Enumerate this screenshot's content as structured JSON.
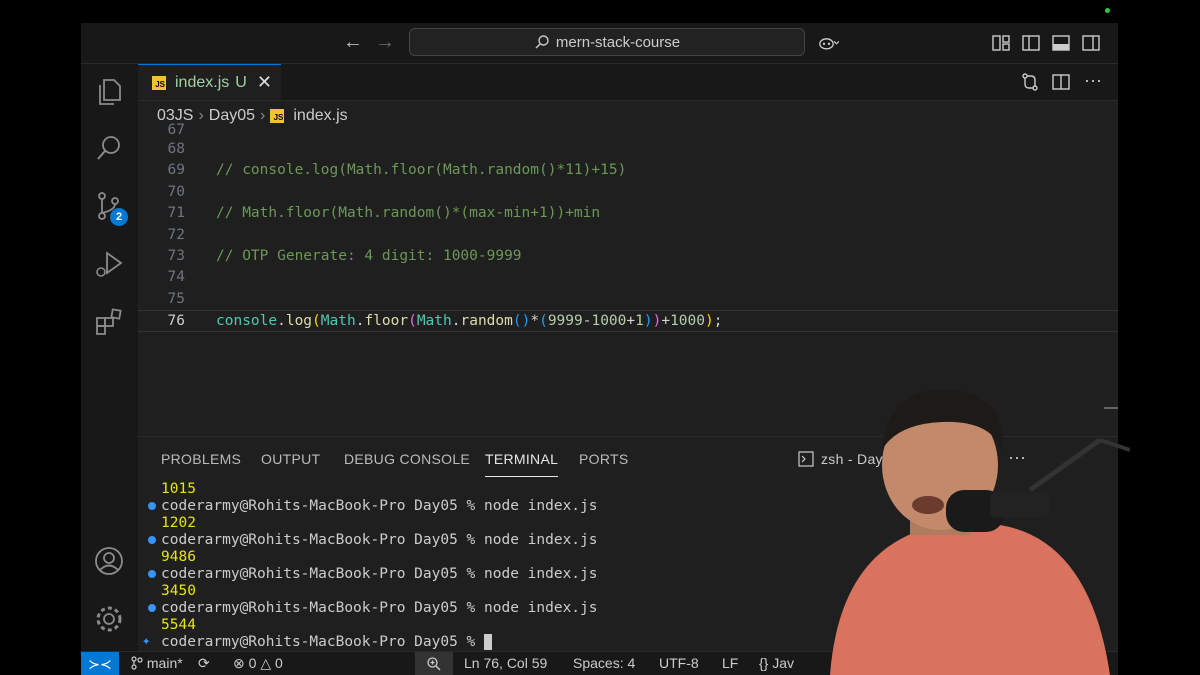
{
  "title_bar": {
    "search_text": "mern-stack-course"
  },
  "activity_bar": {
    "source_control_badge": "2"
  },
  "tab": {
    "filename": "index.js",
    "status": "U",
    "icon_label": "JS"
  },
  "breadcrumb": {
    "parts": [
      "03JS",
      "Day05",
      "index.js"
    ]
  },
  "editor": {
    "partial_line_number": "67",
    "lines": [
      {
        "num": "68",
        "text": ""
      },
      {
        "num": "69",
        "text": "// console.log(Math.floor(Math.random()*11)+15)"
      },
      {
        "num": "70",
        "text": ""
      },
      {
        "num": "71",
        "text": "// Math.floor(Math.random()*(max-min+1))+min"
      },
      {
        "num": "72",
        "text": ""
      },
      {
        "num": "73",
        "text": "// OTP Generate: 4 digit: 1000-9999"
      },
      {
        "num": "74",
        "text": ""
      },
      {
        "num": "75",
        "text": ""
      },
      {
        "num": "76",
        "text": "console.log(Math.floor(Math.random()*(9999-1000+1))+1000);"
      }
    ]
  },
  "panel": {
    "tabs": [
      "PROBLEMS",
      "OUTPUT",
      "DEBUG CONSOLE",
      "TERMINAL",
      "PORTS"
    ],
    "active_tab": "TERMINAL",
    "terminal_name": "zsh - Day0",
    "terminal_lines": [
      {
        "type": "out",
        "text": "1015"
      },
      {
        "type": "cmd",
        "text": "coderarmy@Rohits-MacBook-Pro Day05 % node index.js"
      },
      {
        "type": "out",
        "text": "1202"
      },
      {
        "type": "cmd",
        "text": "coderarmy@Rohits-MacBook-Pro Day05 % node index.js"
      },
      {
        "type": "out",
        "text": "9486"
      },
      {
        "type": "cmd",
        "text": "coderarmy@Rohits-MacBook-Pro Day05 % node index.js"
      },
      {
        "type": "out",
        "text": "3450"
      },
      {
        "type": "cmd",
        "text": "coderarmy@Rohits-MacBook-Pro Day05 % node index.js"
      },
      {
        "type": "out",
        "text": "5544"
      },
      {
        "type": "prompt",
        "text": "coderarmy@Rohits-MacBook-Pro Day05 % "
      }
    ]
  },
  "status_bar": {
    "branch": "main*",
    "errors": "0",
    "warnings": "0",
    "cursor_pos": "Ln 76, Col 59",
    "spaces": "Spaces: 4",
    "encoding": "UTF-8",
    "eol": "LF",
    "language": "Jav"
  },
  "colors": {
    "accent": "#0078d4",
    "comment": "#6a9955",
    "terminal_output": "#e5e510"
  }
}
